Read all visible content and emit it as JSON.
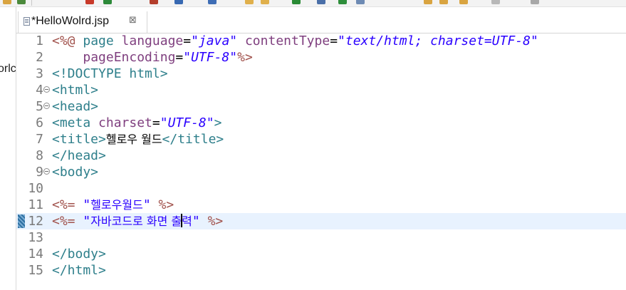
{
  "left_pane": {
    "fragment": "orlc"
  },
  "editor": {
    "tab": {
      "title": "*HelloWolrd.jsp",
      "close_glyph": "⊠",
      "icon": "jsp-file-icon"
    },
    "lines": [
      {
        "num": "1",
        "parts": [
          "<%@",
          " page ",
          "language",
          "=",
          "\"java\"",
          " ",
          "contentType",
          "=",
          "\"text/html; charset=UTF-8\""
        ]
      },
      {
        "num": "2",
        "parts": [
          "    ",
          "pageEncoding",
          "=",
          "\"UTF-8\"",
          "%>"
        ]
      },
      {
        "num": "3",
        "parts": [
          "<!DOCTYPE html>"
        ]
      },
      {
        "num": "4",
        "parts": [
          "<html>"
        ]
      },
      {
        "num": "5",
        "parts": [
          "<head>"
        ]
      },
      {
        "num": "6",
        "parts": [
          "<meta ",
          "charset",
          "=",
          "\"UTF-8\"",
          ">"
        ]
      },
      {
        "num": "7",
        "parts": [
          "<title>",
          "헬로우 월드",
          "</title>"
        ]
      },
      {
        "num": "8",
        "parts": [
          "</head>"
        ]
      },
      {
        "num": "9",
        "parts": [
          "<body>"
        ]
      },
      {
        "num": "10",
        "parts": []
      },
      {
        "num": "11",
        "parts": [
          "<%=",
          " \"",
          "헬로우월드",
          "\" ",
          "%>"
        ]
      },
      {
        "num": "12",
        "parts": [
          "<%=",
          " \"",
          "자바코드로 화면 출",
          "력",
          "\" ",
          "%>"
        ]
      },
      {
        "num": "13",
        "parts": []
      },
      {
        "num": "14",
        "parts": [
          "</body>"
        ]
      },
      {
        "num": "15",
        "parts": [
          "</html>"
        ]
      }
    ]
  }
}
